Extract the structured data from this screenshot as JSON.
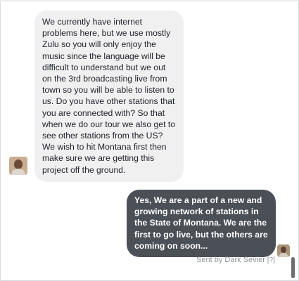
{
  "messages": [
    {
      "direction": "incoming",
      "text": "We currently have internet problems here, but we use mostly Zulu so you will only enjoy the music since the language will be difficult to understand but we out on the 3rd broadcasting live from town so you will be able to listen to us. Do you have other stations that you are connected with? So that when we do our tour we also get to see other stations from the US? We wish to hit Montana first then make sure we are getting this project off the ground."
    },
    {
      "direction": "outgoing",
      "text": "Yes,  We are a part of a new and growing network of stations in the State of Montana. We are the first to go live, but the others are coming on soon..."
    }
  ],
  "status": {
    "sent_by": "Sent by Dark Sevier",
    "help": "[?]"
  },
  "colors": {
    "incoming_bubble": "#f1f0f0",
    "outgoing_bubble": "#4b4f56",
    "status_text": "#90949c"
  }
}
